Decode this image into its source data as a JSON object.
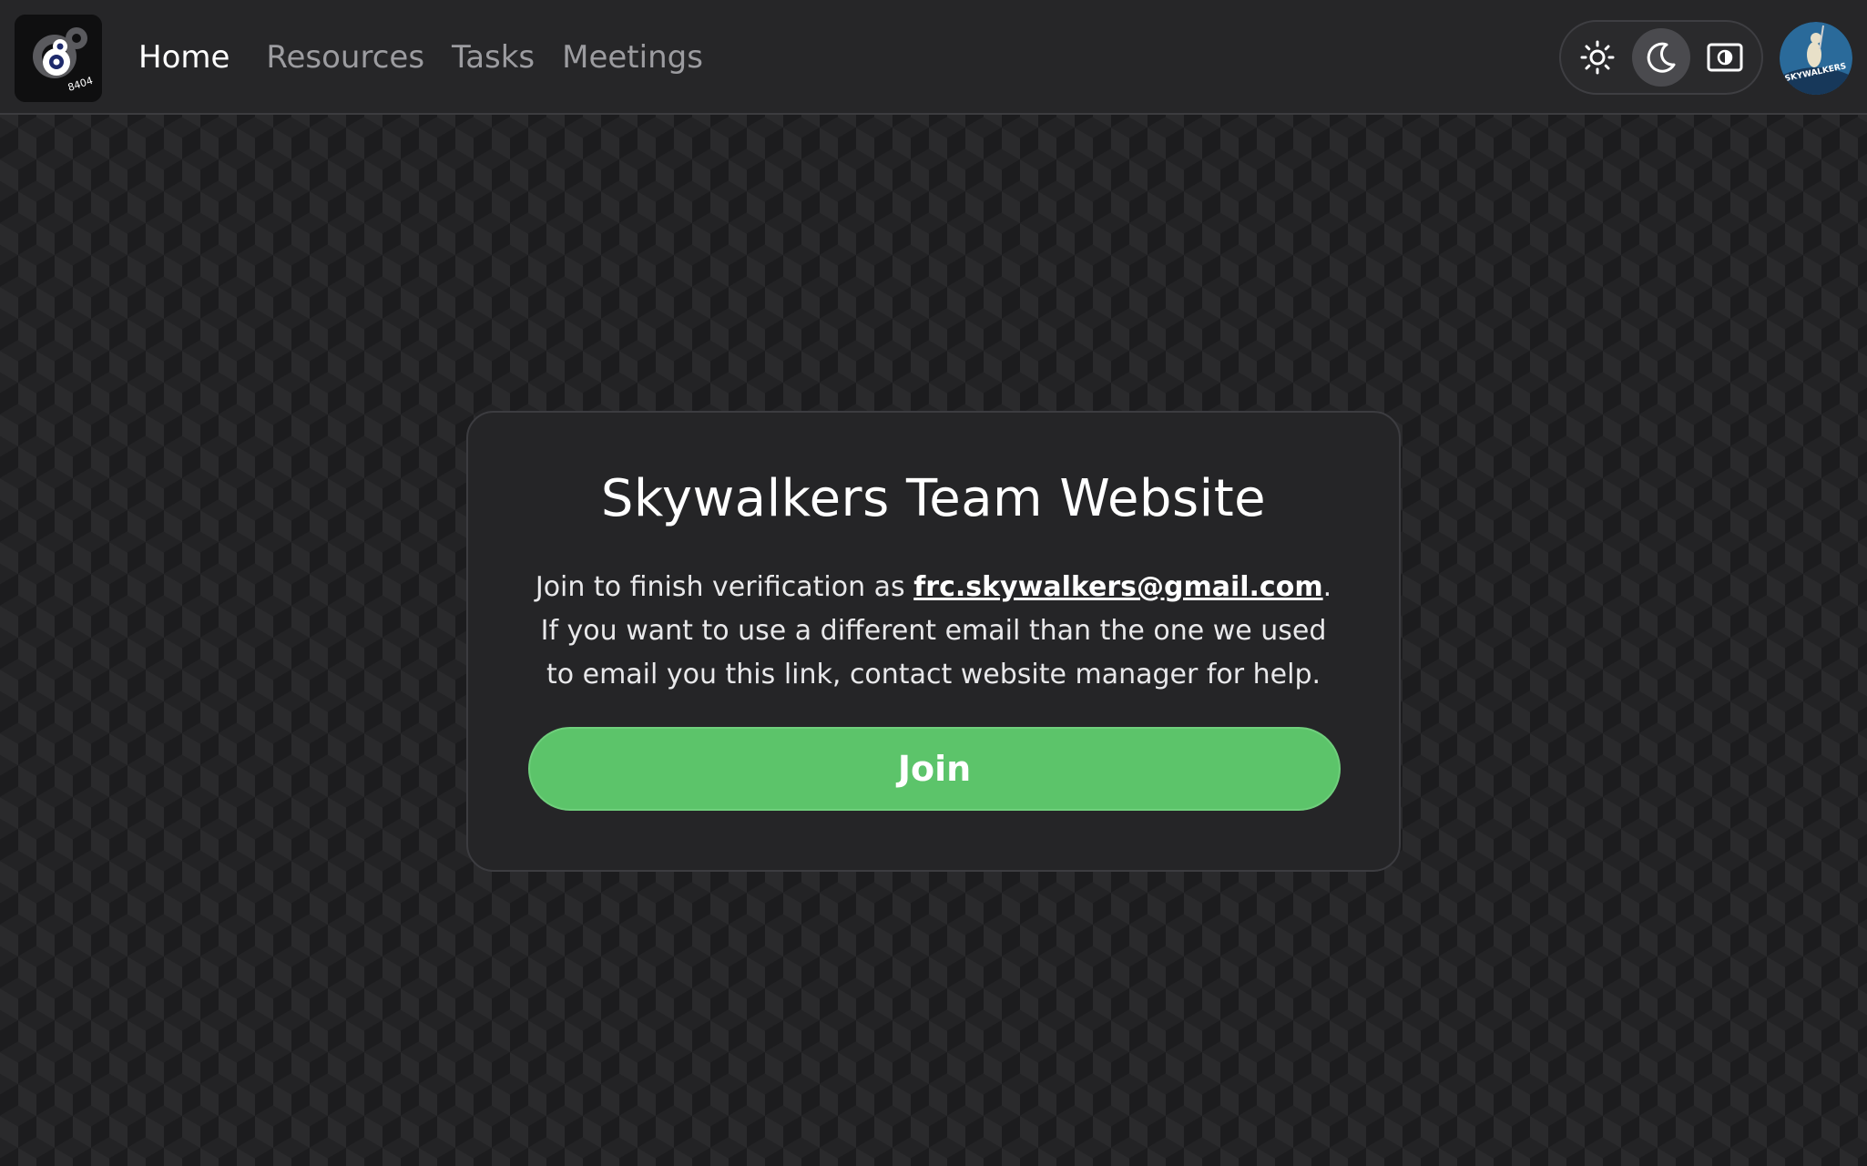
{
  "nav": {
    "links": [
      {
        "label": "Home",
        "active": true
      },
      {
        "label": "Resources",
        "active": false
      },
      {
        "label": "Tasks",
        "active": false
      },
      {
        "label": "Meetings",
        "active": false
      }
    ],
    "logo_text": "8404",
    "theme_options": [
      "sun-icon",
      "moon-icon",
      "system-theme-icon"
    ],
    "theme_selected": "moon-icon",
    "avatar_text": "SKYWALKERS"
  },
  "card": {
    "title": "Skywalkers Team Website",
    "text_before": "Join to finish verification as ",
    "email": "frc.skywalkers@gmail.com",
    "text_after": ". If you want to use a different email than the one we used to email you this link, contact website manager for help.",
    "button_label": "Join"
  },
  "colors": {
    "accent_green": "#5cc46a",
    "nav_background": "#262628",
    "card_background": "#252527"
  }
}
